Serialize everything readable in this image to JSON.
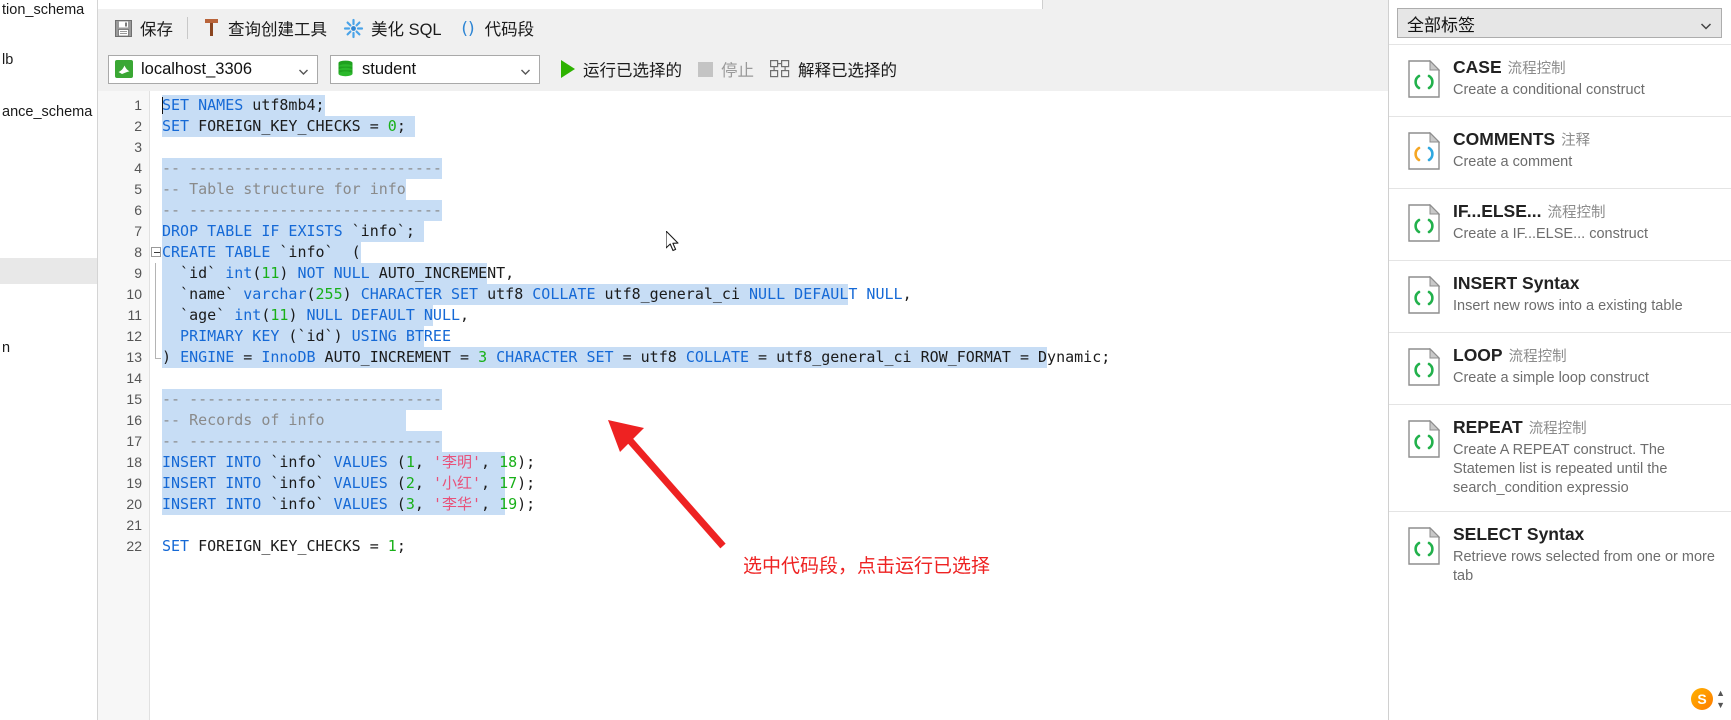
{
  "left_navigator": {
    "items": [
      {
        "label": "tion_schema",
        "selected": false
      },
      {
        "label": "lb",
        "selected": false
      },
      {
        "label": "ance_schema",
        "selected": false
      },
      {
        "label": "",
        "selected": true
      },
      {
        "label": "n",
        "selected": false
      }
    ]
  },
  "toolbar": {
    "save_label": "保存",
    "query_builder_label": "查询创建工具",
    "beautify_label": "美化 SQL",
    "snippet_label": "代码段",
    "icons": {
      "save": "save-icon",
      "query_builder": "query-builder-icon",
      "beautify": "beautify-sql-icon",
      "snippet": "code-snippet-icon"
    }
  },
  "connection_bar": {
    "connection_value": "localhost_3306",
    "database_value": "student",
    "run_selected_label": "运行已选择的",
    "stop_label": "停止",
    "explain_selected_label": "解释已选择的",
    "icons": {
      "connection": "mysql-dolphin-icon",
      "database": "database-icon",
      "run": "play-triangle-icon",
      "stop": "stop-square-icon",
      "explain": "explain-plan-icon",
      "dropdown": "chevron-down-icon"
    }
  },
  "editor": {
    "total_lines": 22,
    "lines": [
      {
        "n": 1,
        "tokens": [
          {
            "t": "SET NAMES",
            "c": "kw"
          },
          {
            "t": " utf8mb4;",
            "c": "pl"
          }
        ],
        "sel_cols": 18
      },
      {
        "n": 2,
        "tokens": [
          {
            "t": "SET",
            "c": "kw"
          },
          {
            "t": " FOREIGN_KEY_CHECKS = ",
            "c": "pl"
          },
          {
            "t": "0",
            "c": "num2"
          },
          {
            "t": ";",
            "c": "pl"
          }
        ],
        "sel_cols": 28
      },
      {
        "n": 3,
        "tokens": [],
        "sel_cols": 0
      },
      {
        "n": 4,
        "tokens": [
          {
            "t": "-- ----------------------------",
            "c": "cmt"
          }
        ],
        "sel_cols": 31
      },
      {
        "n": 5,
        "tokens": [
          {
            "t": "-- Table structure for info",
            "c": "cmt"
          }
        ],
        "sel_cols": 27
      },
      {
        "n": 6,
        "tokens": [
          {
            "t": "-- ----------------------------",
            "c": "cmt"
          }
        ],
        "sel_cols": 31
      },
      {
        "n": 7,
        "tokens": [
          {
            "t": "DROP TABLE IF EXISTS",
            "c": "kw"
          },
          {
            "t": " `info`;",
            "c": "pl"
          }
        ],
        "sel_cols": 29
      },
      {
        "n": 8,
        "tokens": [
          {
            "t": "CREATE TABLE",
            "c": "kw"
          },
          {
            "t": " `info`  (",
            "c": "pl"
          }
        ],
        "sel_cols": 22,
        "fold": "start"
      },
      {
        "n": 9,
        "tokens": [
          {
            "t": "  `id` ",
            "c": "pl"
          },
          {
            "t": "int",
            "c": "kw"
          },
          {
            "t": "(",
            "c": "pl"
          },
          {
            "t": "11",
            "c": "num2"
          },
          {
            "t": ") ",
            "c": "pl"
          },
          {
            "t": "NOT NULL",
            "c": "kw"
          },
          {
            "t": " AUTO_INCREMENT,",
            "c": "pl"
          }
        ],
        "sel_cols": 36,
        "fold": "mid"
      },
      {
        "n": 10,
        "tokens": [
          {
            "t": "  `name` ",
            "c": "pl"
          },
          {
            "t": "varchar",
            "c": "kw"
          },
          {
            "t": "(",
            "c": "pl"
          },
          {
            "t": "255",
            "c": "num2"
          },
          {
            "t": ") ",
            "c": "pl"
          },
          {
            "t": "CHARACTER SET",
            "c": "kw"
          },
          {
            "t": " utf8 ",
            "c": "pl"
          },
          {
            "t": "COLLATE",
            "c": "kw"
          },
          {
            "t": " utf8_general_ci ",
            "c": "pl"
          },
          {
            "t": "NULL DEFAULT NULL",
            "c": "kw"
          },
          {
            "t": ",",
            "c": "pl"
          }
        ],
        "sel_cols": 76,
        "fold": "mid"
      },
      {
        "n": 11,
        "tokens": [
          {
            "t": "  `age` ",
            "c": "pl"
          },
          {
            "t": "int",
            "c": "kw"
          },
          {
            "t": "(",
            "c": "pl"
          },
          {
            "t": "11",
            "c": "num2"
          },
          {
            "t": ") ",
            "c": "pl"
          },
          {
            "t": "NULL DEFAULT NULL",
            "c": "kw"
          },
          {
            "t": ",",
            "c": "pl"
          }
        ],
        "sel_cols": 30,
        "fold": "mid"
      },
      {
        "n": 12,
        "tokens": [
          {
            "t": "  PRIMARY KEY",
            "c": "kw"
          },
          {
            "t": " (`id`) ",
            "c": "pl"
          },
          {
            "t": "USING BTREE",
            "c": "kw"
          }
        ],
        "sel_cols": 29,
        "fold": "mid"
      },
      {
        "n": 13,
        "tokens": [
          {
            "t": ") ",
            "c": "pl"
          },
          {
            "t": "ENGINE",
            "c": "kw"
          },
          {
            "t": " = ",
            "c": "pl"
          },
          {
            "t": "InnoDB",
            "c": "kw"
          },
          {
            "t": " AUTO_INCREMENT = ",
            "c": "pl"
          },
          {
            "t": "3",
            "c": "num2"
          },
          {
            "t": " ",
            "c": "pl"
          },
          {
            "t": "CHARACTER SET",
            "c": "kw"
          },
          {
            "t": " = utf8 ",
            "c": "pl"
          },
          {
            "t": "COLLATE",
            "c": "kw"
          },
          {
            "t": " = utf8_general_ci ROW_FORMAT = Dynamic;",
            "c": "pl"
          }
        ],
        "sel_cols": 98,
        "fold": "end"
      },
      {
        "n": 14,
        "tokens": [],
        "sel_cols": 0
      },
      {
        "n": 15,
        "tokens": [
          {
            "t": "-- ----------------------------",
            "c": "cmt"
          }
        ],
        "sel_cols": 31
      },
      {
        "n": 16,
        "tokens": [
          {
            "t": "-- Records of info",
            "c": "cmt"
          }
        ],
        "sel_cols": 27
      },
      {
        "n": 17,
        "tokens": [
          {
            "t": "-- ----------------------------",
            "c": "cmt"
          }
        ],
        "sel_cols": 31
      },
      {
        "n": 18,
        "tokens": [
          {
            "t": "INSERT INTO",
            "c": "kw"
          },
          {
            "t": " `info` ",
            "c": "pl"
          },
          {
            "t": "VALUES",
            "c": "kw"
          },
          {
            "t": " (",
            "c": "pl"
          },
          {
            "t": "1",
            "c": "num2"
          },
          {
            "t": ", ",
            "c": "pl"
          },
          {
            "t": "'李明'",
            "c": "str"
          },
          {
            "t": ", ",
            "c": "pl"
          },
          {
            "t": "18",
            "c": "num2"
          },
          {
            "t": ");",
            "c": "pl"
          }
        ],
        "sel_cols": 38
      },
      {
        "n": 19,
        "tokens": [
          {
            "t": "INSERT INTO",
            "c": "kw"
          },
          {
            "t": " `info` ",
            "c": "pl"
          },
          {
            "t": "VALUES",
            "c": "kw"
          },
          {
            "t": " (",
            "c": "pl"
          },
          {
            "t": "2",
            "c": "num2"
          },
          {
            "t": ", ",
            "c": "pl"
          },
          {
            "t": "'小红'",
            "c": "str"
          },
          {
            "t": ", ",
            "c": "pl"
          },
          {
            "t": "17",
            "c": "num2"
          },
          {
            "t": ");",
            "c": "pl"
          }
        ],
        "sel_cols": 38
      },
      {
        "n": 20,
        "tokens": [
          {
            "t": "INSERT INTO",
            "c": "kw"
          },
          {
            "t": " `info` ",
            "c": "pl"
          },
          {
            "t": "VALUES",
            "c": "kw"
          },
          {
            "t": " (",
            "c": "pl"
          },
          {
            "t": "3",
            "c": "num2"
          },
          {
            "t": ", ",
            "c": "pl"
          },
          {
            "t": "'李华'",
            "c": "str"
          },
          {
            "t": ", ",
            "c": "pl"
          },
          {
            "t": "19",
            "c": "num2"
          },
          {
            "t": ");",
            "c": "pl"
          }
        ],
        "sel_cols": 38
      },
      {
        "n": 21,
        "tokens": [],
        "sel_cols": 0
      },
      {
        "n": 22,
        "tokens": [
          {
            "t": "SET",
            "c": "kw"
          },
          {
            "t": " FOREIGN_KEY_CHECKS = ",
            "c": "pl"
          },
          {
            "t": "1",
            "c": "num2"
          },
          {
            "t": ";",
            "c": "pl"
          }
        ],
        "sel_cols": 0
      }
    ]
  },
  "annotation": {
    "text": "选中代码段，点击运行已选择",
    "color": "#ee2222"
  },
  "snippet_panel": {
    "filter_value": "全部标签",
    "items": [
      {
        "title": "CASE",
        "tag": "流程控制",
        "desc": "Create a conditional construct",
        "icon": "code-snippet-icon",
        "icon_color": "green"
      },
      {
        "title": "COMMENTS",
        "tag": "注释",
        "desc": "Create a comment",
        "icon": "code-snippet-icon",
        "icon_color": "multi"
      },
      {
        "title": "IF...ELSE...",
        "tag": "流程控制",
        "desc": "Create a IF...ELSE... construct",
        "icon": "code-snippet-icon",
        "icon_color": "green"
      },
      {
        "title": "INSERT Syntax",
        "tag": "",
        "desc": "Insert new rows into a existing table",
        "icon": "code-snippet-icon",
        "icon_color": "green"
      },
      {
        "title": "LOOP",
        "tag": "流程控制",
        "desc": "Create a simple loop construct",
        "icon": "code-snippet-icon",
        "icon_color": "green"
      },
      {
        "title": "REPEAT",
        "tag": "流程控制",
        "desc": "Create A REPEAT construct. The Statemen list is repeated until the search_condition expressio",
        "icon": "code-snippet-icon",
        "icon_color": "green"
      },
      {
        "title": "SELECT Syntax",
        "tag": "",
        "desc": "Retrieve rows selected from one or more tab",
        "icon": "code-snippet-icon",
        "icon_color": "green"
      }
    ],
    "ime_badge": "S"
  }
}
